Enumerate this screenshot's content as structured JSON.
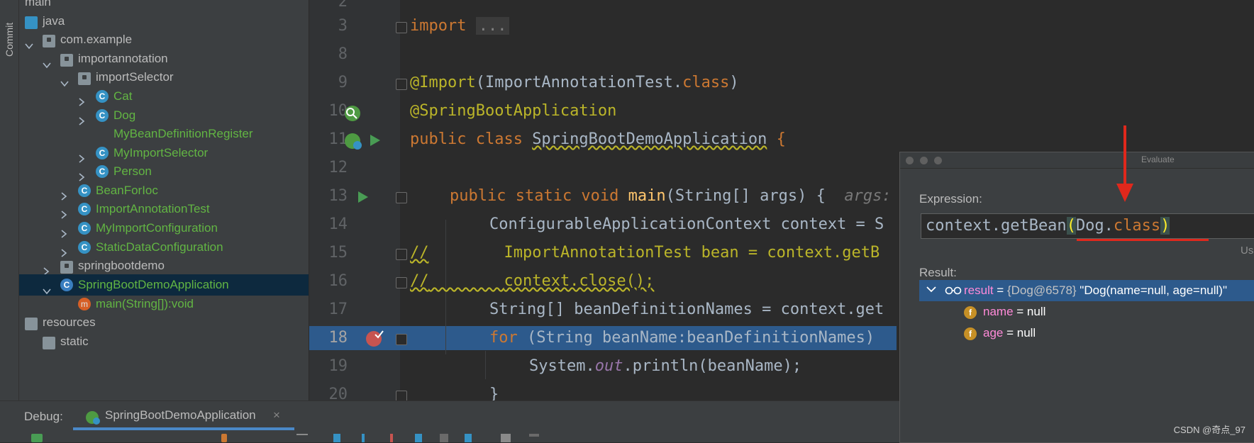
{
  "sidebar": {
    "commit_label": "Commit"
  },
  "tree": {
    "top_partial": "main",
    "items": [
      {
        "label": "java"
      },
      {
        "label": "com.example"
      },
      {
        "label": "importannotation"
      },
      {
        "label": "importSelector"
      },
      {
        "label": "Cat"
      },
      {
        "label": "Dog"
      },
      {
        "label": "MyBeanDefinitionRegister"
      },
      {
        "label": "MyImportSelector"
      },
      {
        "label": "Person"
      },
      {
        "label": "BeanForIoc"
      },
      {
        "label": "ImportAnnotationTest"
      },
      {
        "label": "MyImportConfiguration"
      },
      {
        "label": "StaticDataConfiguration"
      },
      {
        "label": "springbootdemo"
      },
      {
        "label": "SpringBootDemoApplication"
      },
      {
        "label": "main(String[]):void"
      },
      {
        "label": "resources"
      },
      {
        "label": "static"
      }
    ]
  },
  "editor": {
    "line_numbers": [
      "2",
      "3",
      "8",
      "9",
      "10",
      "11",
      "12",
      "13",
      "14",
      "15",
      "16",
      "17",
      "18",
      "19",
      "20"
    ],
    "lines": {
      "l3_kw": "import",
      "l3_fold": "...",
      "l9_ann": "@Import",
      "l9_a": "(ImportAnnotationTest.",
      "l9_kw": "class",
      "l9_b": ")",
      "l10_ann": "@SpringBootApplication",
      "l11_kw": "public class ",
      "l11_name": "SpringBootDemoApplication",
      "l11_brace": " {",
      "l13_kw": "public static void ",
      "l13_fn": "main",
      "l13_args": "(String[] args) {",
      "l13_hint": "args:",
      "l14": "ConfigurableApplicationContext context = S",
      "l15_cmt": "//",
      "l15_code": "ImportAnnotationTest bean = context.getB",
      "l16_cmt": "//",
      "l16_code": "context.close();",
      "l17": "String[] beanDefinitionNames = context.get",
      "l18_kw": "for",
      "l18_code": " (String beanName:beanDefinitionNames)",
      "l19_a": "System.",
      "l19_out": "out",
      "l19_b": ".println(beanName);",
      "l20": "}"
    }
  },
  "evaluate": {
    "title": "Evaluate",
    "expression_label": "Expression:",
    "expression_a": "context.getBean",
    "expression_paren_open": "(",
    "expression_mid": "Dog.",
    "expression_kw": "class",
    "expression_paren_close": ")",
    "use_partial": "Us",
    "result_label": "Result:",
    "result": {
      "name": "result",
      "eq": " = ",
      "type": "{Dog@6578}",
      "value": " \"Dog(name=null, age=null)\""
    },
    "fields": [
      {
        "name": "name",
        "value": " = null"
      },
      {
        "name": "age",
        "value": " = null"
      }
    ]
  },
  "debug": {
    "label": "Debug:",
    "tab": "SpringBootDemoApplication",
    "close": "×"
  },
  "watermark": "CSDN @奇点_97",
  "colors": {
    "accent": "#2d5a8c",
    "annotation_red": "#e0281c",
    "keyword": "#cc7832"
  }
}
